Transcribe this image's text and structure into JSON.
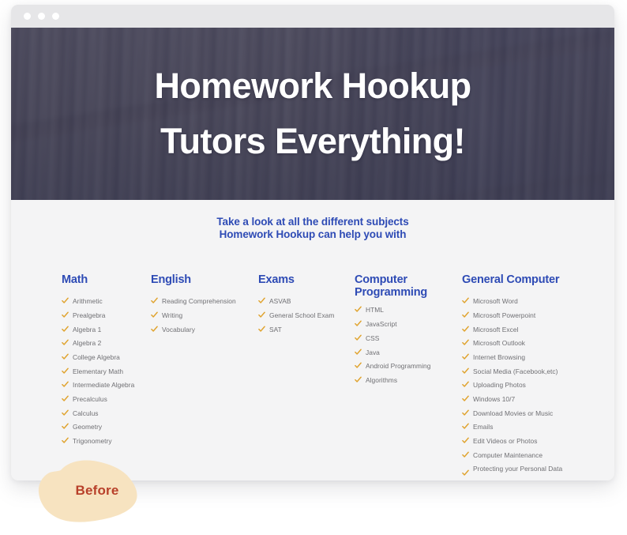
{
  "window": {
    "traffic_lights": [
      "close-dot",
      "minimize-dot",
      "maximize-dot"
    ]
  },
  "hero": {
    "background_image": "bookshelf-photo",
    "overlay_color": "#3f415f",
    "title_line_1": "Homework Hookup",
    "title_line_2": "Tutors Everything!",
    "title_color": "#ffffff"
  },
  "intro": {
    "line_1": "Take a look at all the different subjects",
    "line_2": "Homework Hookup can help you with",
    "color": "#2e4bb5"
  },
  "colors": {
    "heading_blue": "#2e4bb5",
    "check_gold": "#e0a32e",
    "list_gray": "#6f6f73",
    "page_bg": "#f4f4f5",
    "titlebar_gray": "#e6e6e8",
    "badge_cream": "#f7e3c0",
    "badge_text_red": "#b8402a"
  },
  "subjects": [
    {
      "title": "Math",
      "items": [
        "Arithmetic",
        "Prealgebra",
        "Algebra 1",
        "Algebra 2",
        "College Algebra",
        "Elementary Math",
        "Intermediate Algebra",
        "Precalculus",
        "Calculus",
        "Geometry",
        "Trigonometry"
      ]
    },
    {
      "title": "English",
      "items": [
        "Reading Comprehension",
        "Writing",
        "Vocabulary"
      ]
    },
    {
      "title": "Exams",
      "items": [
        "ASVAB",
        "General School Exam",
        "SAT"
      ]
    },
    {
      "title": "Computer Programming",
      "items": [
        "HTML",
        "JavaScript",
        "CSS",
        "Java",
        "Android Programming",
        "Algorithms"
      ]
    },
    {
      "title": "General Computer",
      "items": [
        "Microsoft Word",
        "Microsoft Powerpoint",
        "Microsoft Excel",
        "Microsoft Outlook",
        "Internet Browsing",
        "Social Media (Facebook,etc)",
        "Uploading Photos",
        "Windows 10/7",
        "Download Movies or Music",
        "Emails",
        "Edit Videos or Photos",
        "Computer Maintenance",
        "Protecting your Personal Data"
      ]
    }
  ],
  "badge": {
    "label": "Before"
  }
}
